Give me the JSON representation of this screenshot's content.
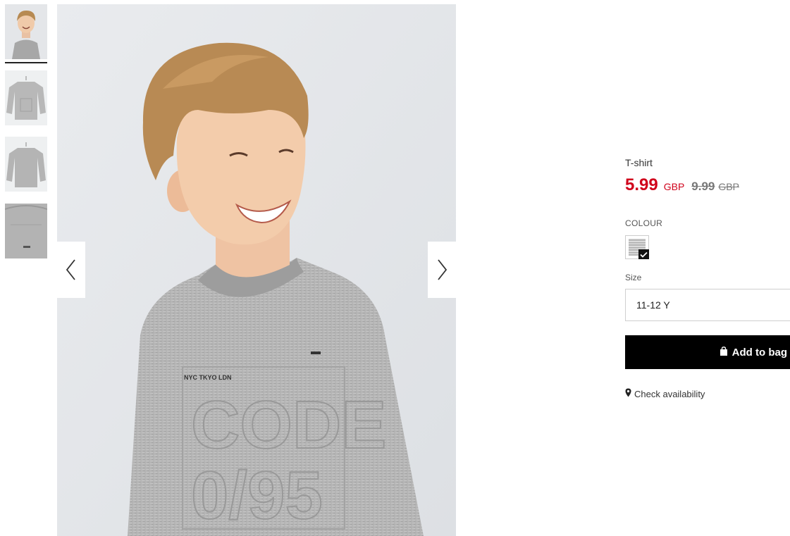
{
  "gallery": {
    "thumbnails": [
      {
        "name": "thumb-model-front",
        "selected": true
      },
      {
        "name": "thumb-shirt-front",
        "selected": false
      },
      {
        "name": "thumb-shirt-back",
        "selected": false
      },
      {
        "name": "thumb-shirt-detail",
        "selected": false
      }
    ],
    "prev_icon": "chevron-left-icon",
    "next_icon": "chevron-right-icon",
    "print_text_1": "NYC TKYO LDN",
    "print_text_2": "CODE",
    "print_text_3": "0/95"
  },
  "product": {
    "name": "T-shirt",
    "price": "5.99",
    "currency": "GBP",
    "old_price": "9.99",
    "old_currency": "GBP",
    "colour_label": "COLOUR",
    "size_label": "Size",
    "selected_size": "11-12 Y",
    "add_to_bag": "Add to bag",
    "check_availability": "Check availability"
  },
  "colors": {
    "sale": "#d0021b",
    "button": "#000000"
  }
}
